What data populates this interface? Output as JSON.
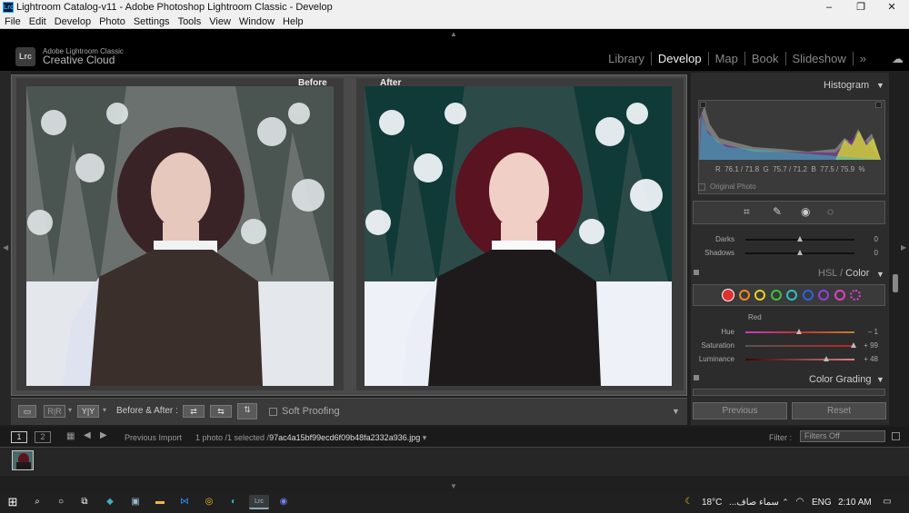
{
  "window": {
    "title": "Lightroom Catalog-v11 - Adobe Photoshop Lightroom Classic - Develop",
    "controls": [
      "–",
      "❐",
      "✕"
    ]
  },
  "menu": [
    "File",
    "Edit",
    "Develop",
    "Photo",
    "Settings",
    "Tools",
    "View",
    "Window",
    "Help"
  ],
  "identity": {
    "logo": "Lrc",
    "line1": "Adobe Lightroom Classic",
    "line2": "Creative Cloud"
  },
  "modules": {
    "items": [
      "Library",
      "Develop",
      "Map",
      "Book",
      "Slideshow"
    ],
    "active": "Develop",
    "more": "»"
  },
  "viewer": {
    "before_label": "Before",
    "after_label": "After"
  },
  "toolbar": {
    "view_loupe": "▭",
    "view_compare": "R|R",
    "view_yy": "Y|Y",
    "before_after_label": "Before & After :",
    "soft_proofing_label": "Soft Proofing"
  },
  "histogram": {
    "title": "Histogram",
    "r": "76.1 / 71.8",
    "g": "75.7 / 71.2",
    "b": "77.5 / 75.9",
    "percent": "%",
    "original_photo": "Original Photo",
    "labels": {
      "r": "R",
      "g": "G",
      "b": "B"
    }
  },
  "basic_tail": {
    "rows": [
      {
        "label": "Darks",
        "value": "0",
        "pos": 0.5
      },
      {
        "label": "Shadows",
        "value": "0",
        "pos": 0.5
      }
    ]
  },
  "hsl": {
    "title_hsl": "HSL",
    "slash": " / ",
    "title_color": "Color",
    "selected_channel": "Red",
    "swatches": [
      "#e03030",
      "#f08a20",
      "#e8d020",
      "#40c040",
      "#30c0c0",
      "#3060e0",
      "#9040e0",
      "#e040c0",
      "#c0c0c0"
    ],
    "rows": [
      {
        "label": "Hue",
        "value": "– 1",
        "pos": 0.49
      },
      {
        "label": "Saturation",
        "value": "+ 99",
        "pos": 0.99
      },
      {
        "label": "Luminance",
        "value": "+ 48",
        "pos": 0.74
      }
    ]
  },
  "color_grading": {
    "title": "Color Grading"
  },
  "bottom_buttons": {
    "previous": "Previous",
    "reset": "Reset"
  },
  "filmstrip_bar": {
    "monitor1": "1",
    "monitor2": "2",
    "source": "Previous Import",
    "count": "1 photo /1 selected /",
    "filename": "97ac4a15bf99ecd6f09b48fa2332a936.jpg",
    "filter_label": "Filter :",
    "filter_value": "Filters Off"
  },
  "taskbar": {
    "weather_temp": "18°C",
    "weather_text": "سماء صاف...",
    "lang": "ENG",
    "time": "2:10 AM"
  }
}
